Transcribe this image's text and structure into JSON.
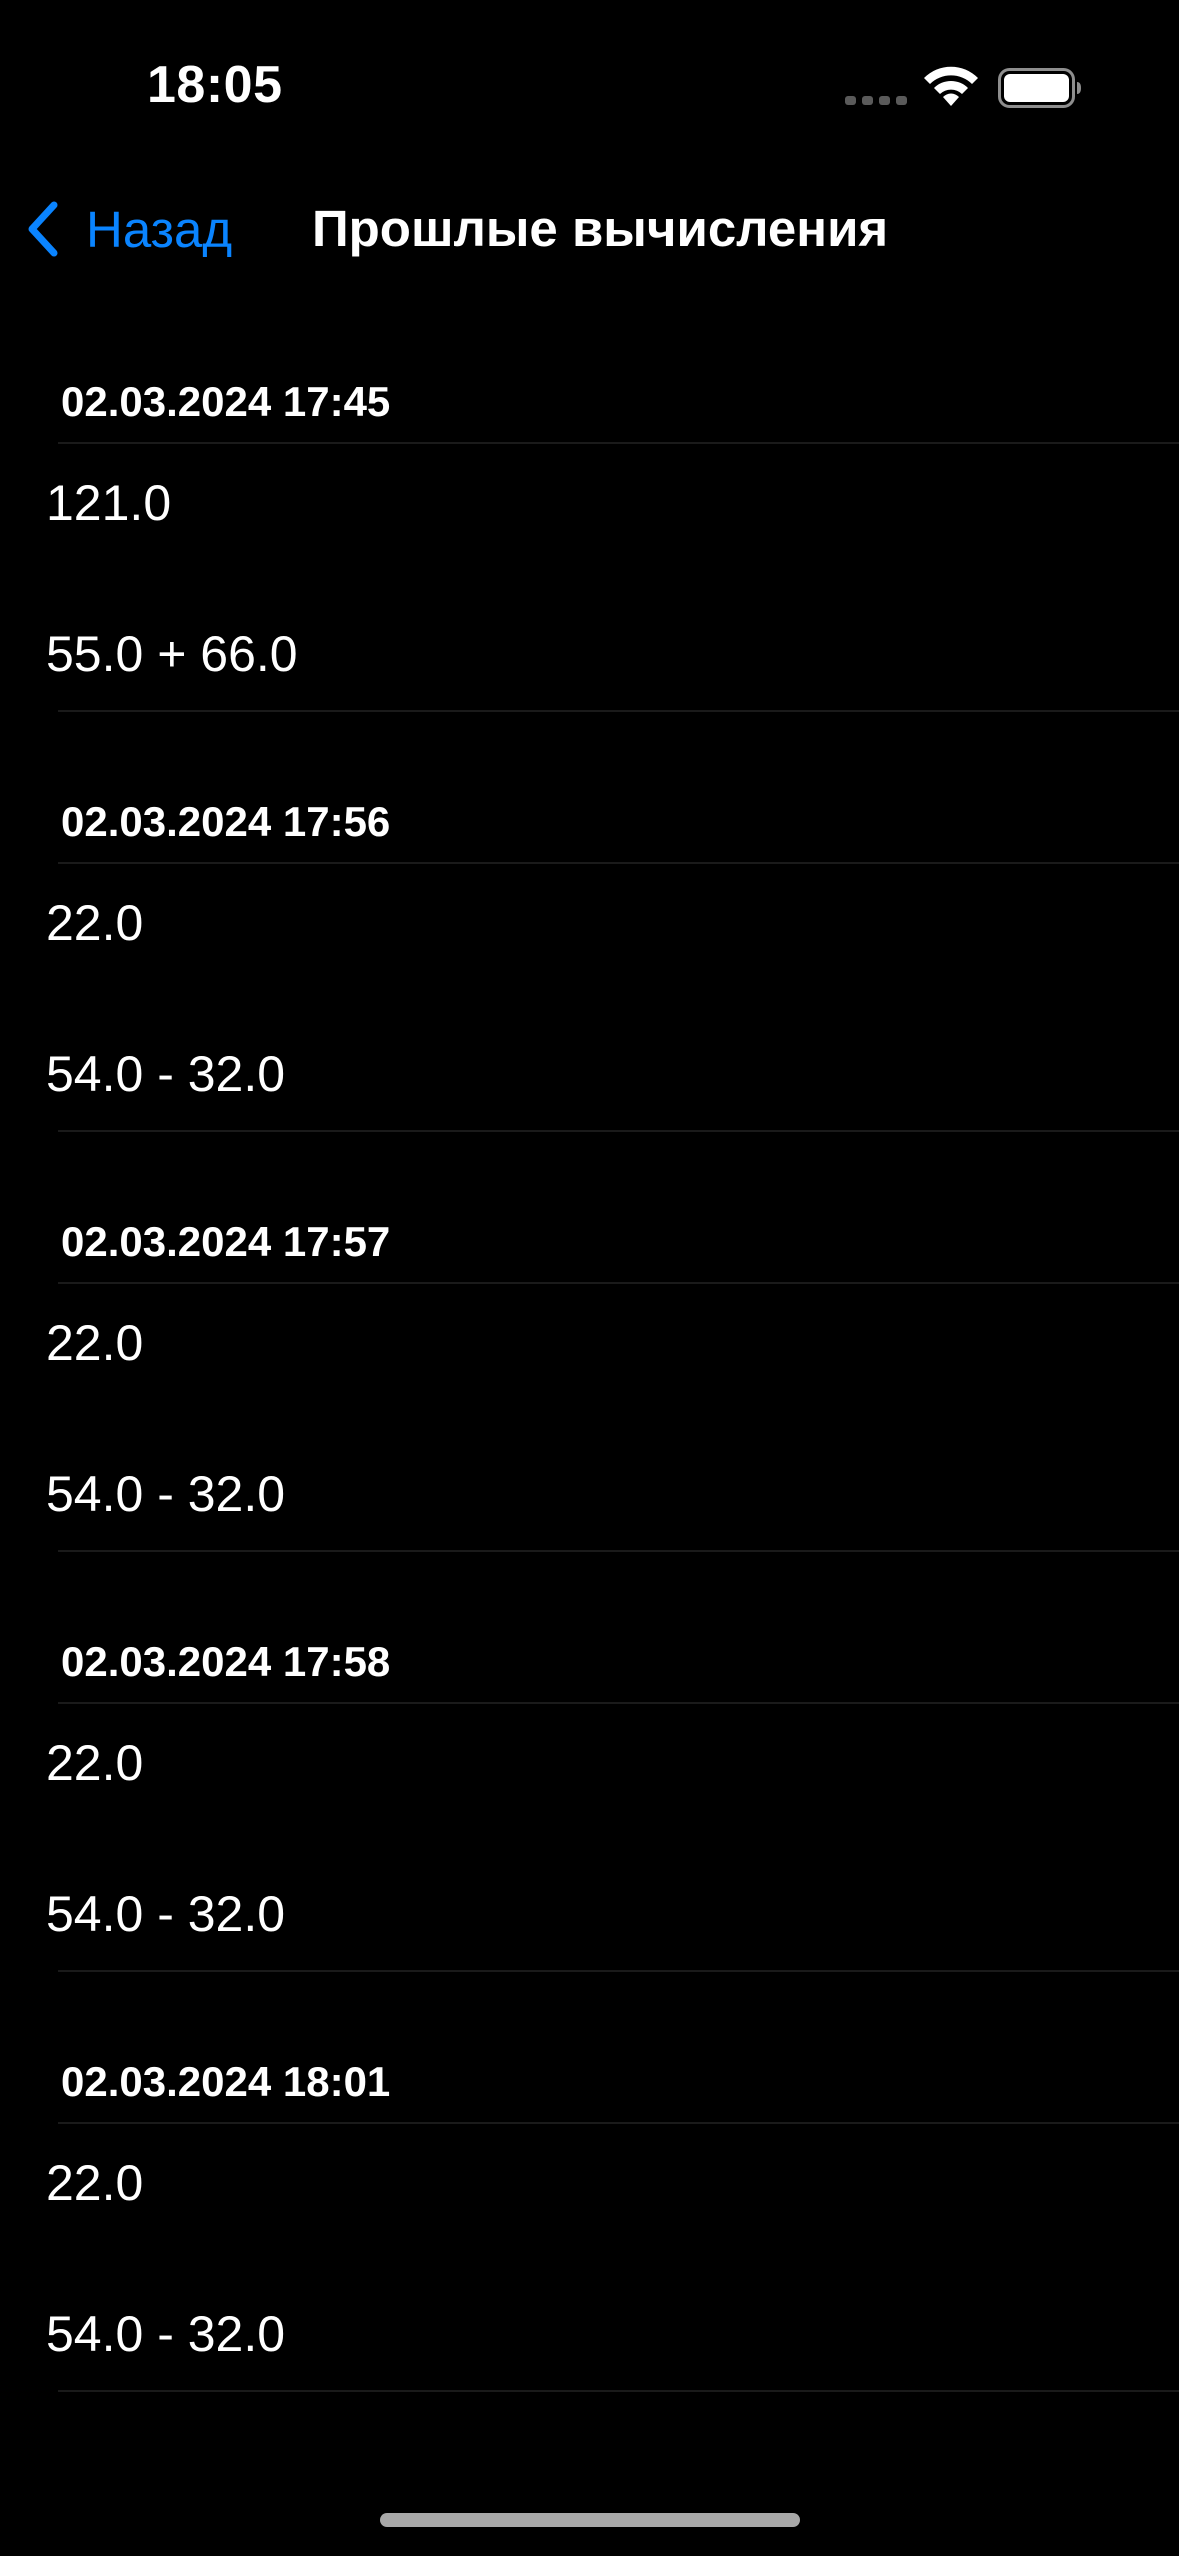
{
  "status_bar": {
    "time": "18:05",
    "icons": [
      "cellular-signal-icon",
      "wifi-icon",
      "battery-icon"
    ]
  },
  "nav": {
    "back_label": "Назад",
    "title": "Прошлые вычисления",
    "accent_color": "#0a84ff"
  },
  "history": [
    {
      "timestamp": "02.03.2024 17:45",
      "result": "121.0",
      "expression": "55.0 + 66.0"
    },
    {
      "timestamp": "02.03.2024 17:56",
      "result": "22.0",
      "expression": "54.0 - 32.0"
    },
    {
      "timestamp": "02.03.2024 17:57",
      "result": "22.0",
      "expression": "54.0 - 32.0"
    },
    {
      "timestamp": "02.03.2024 17:58",
      "result": "22.0",
      "expression": "54.0 - 32.0"
    },
    {
      "timestamp": "02.03.2024 18:01",
      "result": "22.0",
      "expression": "54.0 - 32.0"
    }
  ]
}
